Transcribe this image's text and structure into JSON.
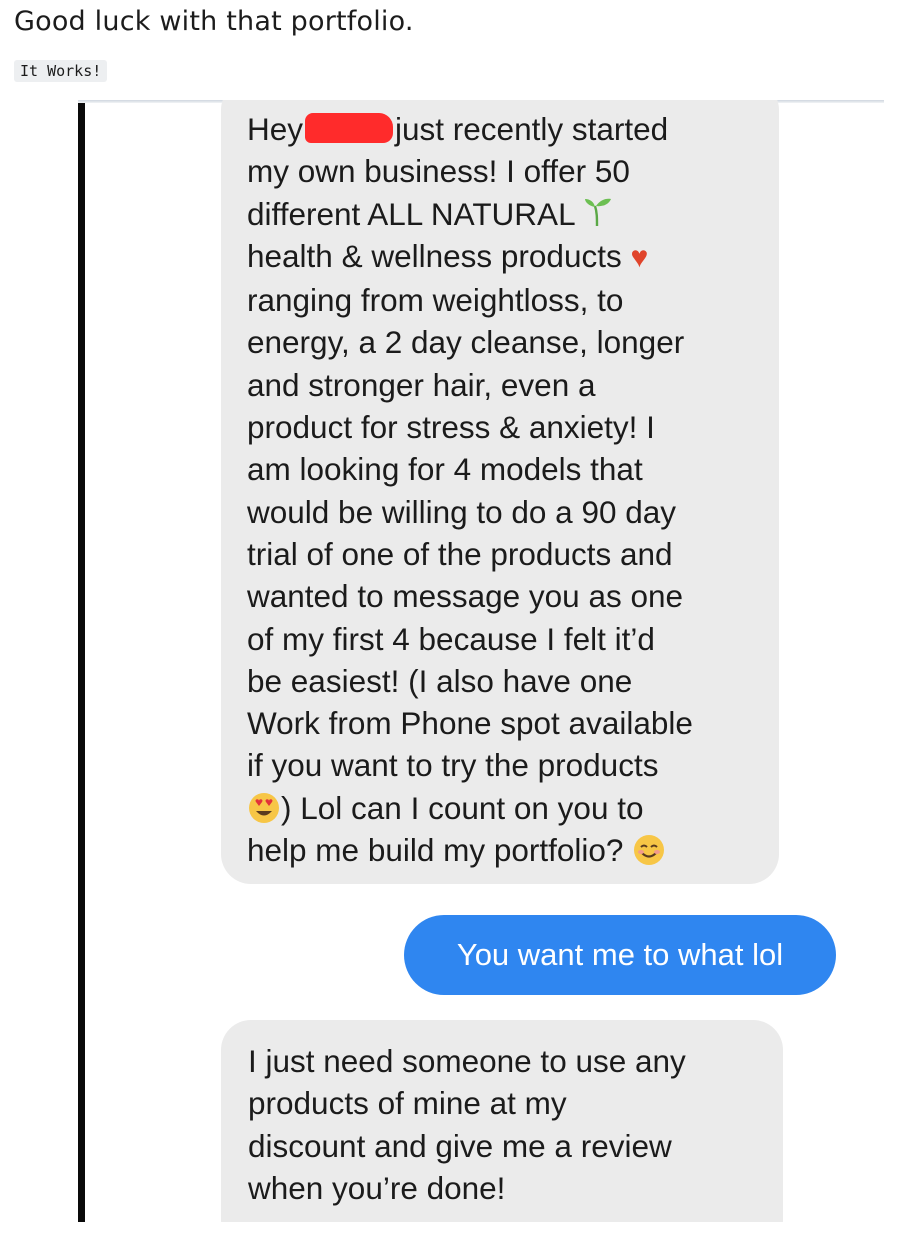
{
  "post": {
    "title": "Good luck with that portfolio.",
    "flair": "It Works!"
  },
  "conversation": {
    "message_1_lines": [
      "just recently started",
      "my own business! I offer 50",
      "different ALL NATURAL",
      "health & wellness products",
      "ranging from weightloss, to",
      "energy, a 2 day cleanse, longer",
      "and stronger hair, even a",
      "product for stress & anxiety! I",
      "am looking for 4 models that",
      "would be willing to do a 90 day",
      "trial of one of the products and",
      "wanted to message you as one",
      "of my first 4 because I felt it’d",
      "be easiest! (I also have one",
      "Work from Phone spot available",
      "if you want to try the products",
      ") Lol can I count on you to",
      "help me build my portfolio?"
    ],
    "greeting": "Hey",
    "reply": "You want me to what lol",
    "message_3_lines": [
      "I just need someone to use any",
      "products of mine at my",
      "discount and give me a review",
      "when you’re done!"
    ],
    "icons": {
      "sprout": "seedling-emoji-icon",
      "heart": "red-heart-emoji-icon",
      "heart_eyes": "heart-eyes-emoji-icon",
      "smile": "smiling-face-emoji-icon",
      "redaction": "red-redaction-mark"
    }
  },
  "colors": {
    "incoming_bubble": "#ebebeb",
    "outgoing_bubble": "#2f86f0",
    "redaction": "#ff2b2b"
  }
}
